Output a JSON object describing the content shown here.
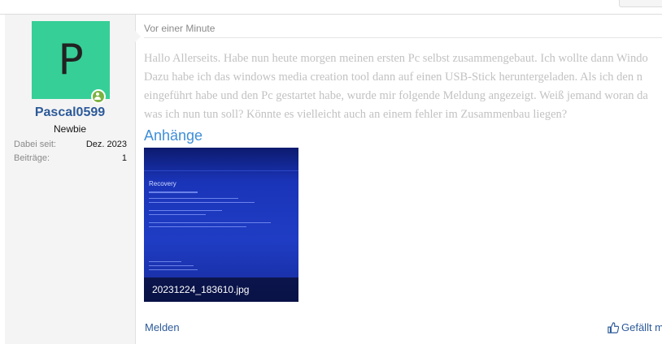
{
  "author": {
    "avatar_letter": "P",
    "username": "Pascal0599",
    "user_title": "Newbie",
    "stats": [
      {
        "label": "Dabei seit:",
        "value": "Dez. 2023"
      },
      {
        "label": "Beiträge:",
        "value": "1"
      }
    ],
    "avatar_color": "#36cf97",
    "online_color": "#7cb342"
  },
  "post": {
    "timestamp": "Vor einer Minute",
    "body_lines": [
      "Hallo Allerseits. Habe nun heute morgen meinen ersten Pc selbst zusammengebaut. Ich wollte dann Windo",
      "Dazu habe ich das windows media creation tool dann auf einen USB-Stick heruntergeladen. Als ich den n",
      "eingeführt habe und den Pc gestartet habe, wurde mir folgende Meldung angezeigt. Weiß jemand woran da",
      "was ich nun tun soll? Könnte es vielleicht auch an einem fehler im Zusammenbau liegen?"
    ],
    "attachments_title": "Anhänge",
    "attachment": {
      "filename": "20231224_183610.jpg",
      "screen_heading": "Recovery"
    },
    "actions": {
      "report_label": "Melden",
      "like_label": "Gefällt mir"
    }
  },
  "colors": {
    "link": "#2c5a99",
    "accent": "#3f8ed8",
    "sidebar_bg": "#f4f4f4"
  }
}
